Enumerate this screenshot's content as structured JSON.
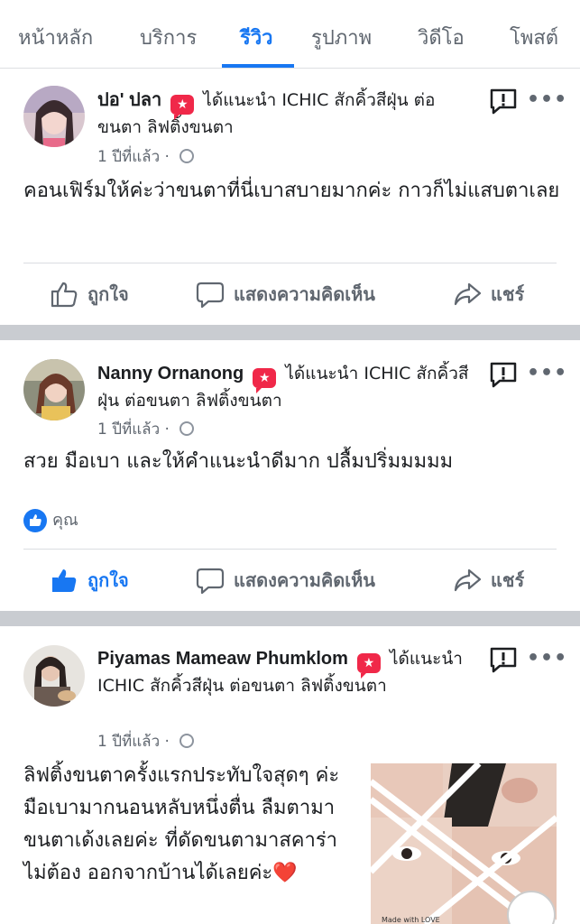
{
  "tabs": [
    {
      "label": "หน้าหลัก"
    },
    {
      "label": "บริการ"
    },
    {
      "label": "รีวิว"
    },
    {
      "label": "รูปภาพ"
    },
    {
      "label": "วิดีโอ"
    },
    {
      "label": "โพสต์"
    }
  ],
  "active_tab": "รีวิว",
  "colors": {
    "accent": "#1877f2",
    "recommend_badge": "#f02849",
    "separator": "#c9ccd1"
  },
  "posts": [
    {
      "author": "ปอ' ปลา",
      "recommend_text": "ได้แนะนำ ICHIC สักคิ้วสีฝุ่น ต่อขนตา ลิฟติ้งขนตา",
      "time": "1 ปีที่แล้ว ·",
      "body": "คอนเฟิร์มให้ค่ะว่าขนตาที่นี่เบาสบายมากค่ะ กาวก็ไม่แสบตาเลย",
      "like": "ถูกใจ",
      "comment": "แสดงความคิดเห็น",
      "share": "แชร์"
    },
    {
      "author": "Nanny Ornanong",
      "recommend_text": "ได้แนะนำ ICHIC สักคิ้วสีฝุ่น ต่อขนตา ลิฟติ้งขนตา",
      "time": "1 ปีที่แล้ว ·",
      "body": "สวย มือเบา และให้คำแนะนำดีมาก ปลื้มปริ่มมมมม",
      "reaction": "คุณ",
      "like": "ถูกใจ",
      "comment": "แสดงความคิดเห็น",
      "share": "แชร์"
    },
    {
      "author": "Piyamas Mameaw Phumklom",
      "recommend_text": "ได้แนะนำ ICHIC สักคิ้วสีฝุ่น ต่อขนตา ลิฟติ้งขนตา",
      "time": "1 ปีที่แล้ว ·",
      "body": "ลิฟติ้งขนตาครั้งแรกประทับใจสุดๆ ค่ะ มือเบามากนอนหลับหนึ่งตื่น ลืมตามาขนตาเด้งเลยค่ะ ที่ดัดขนตามาสคาร่าไม่ต้อง ออกจากบ้านได้เลยค่ะ❤️",
      "image_caption": "Made with LOVE"
    }
  ]
}
